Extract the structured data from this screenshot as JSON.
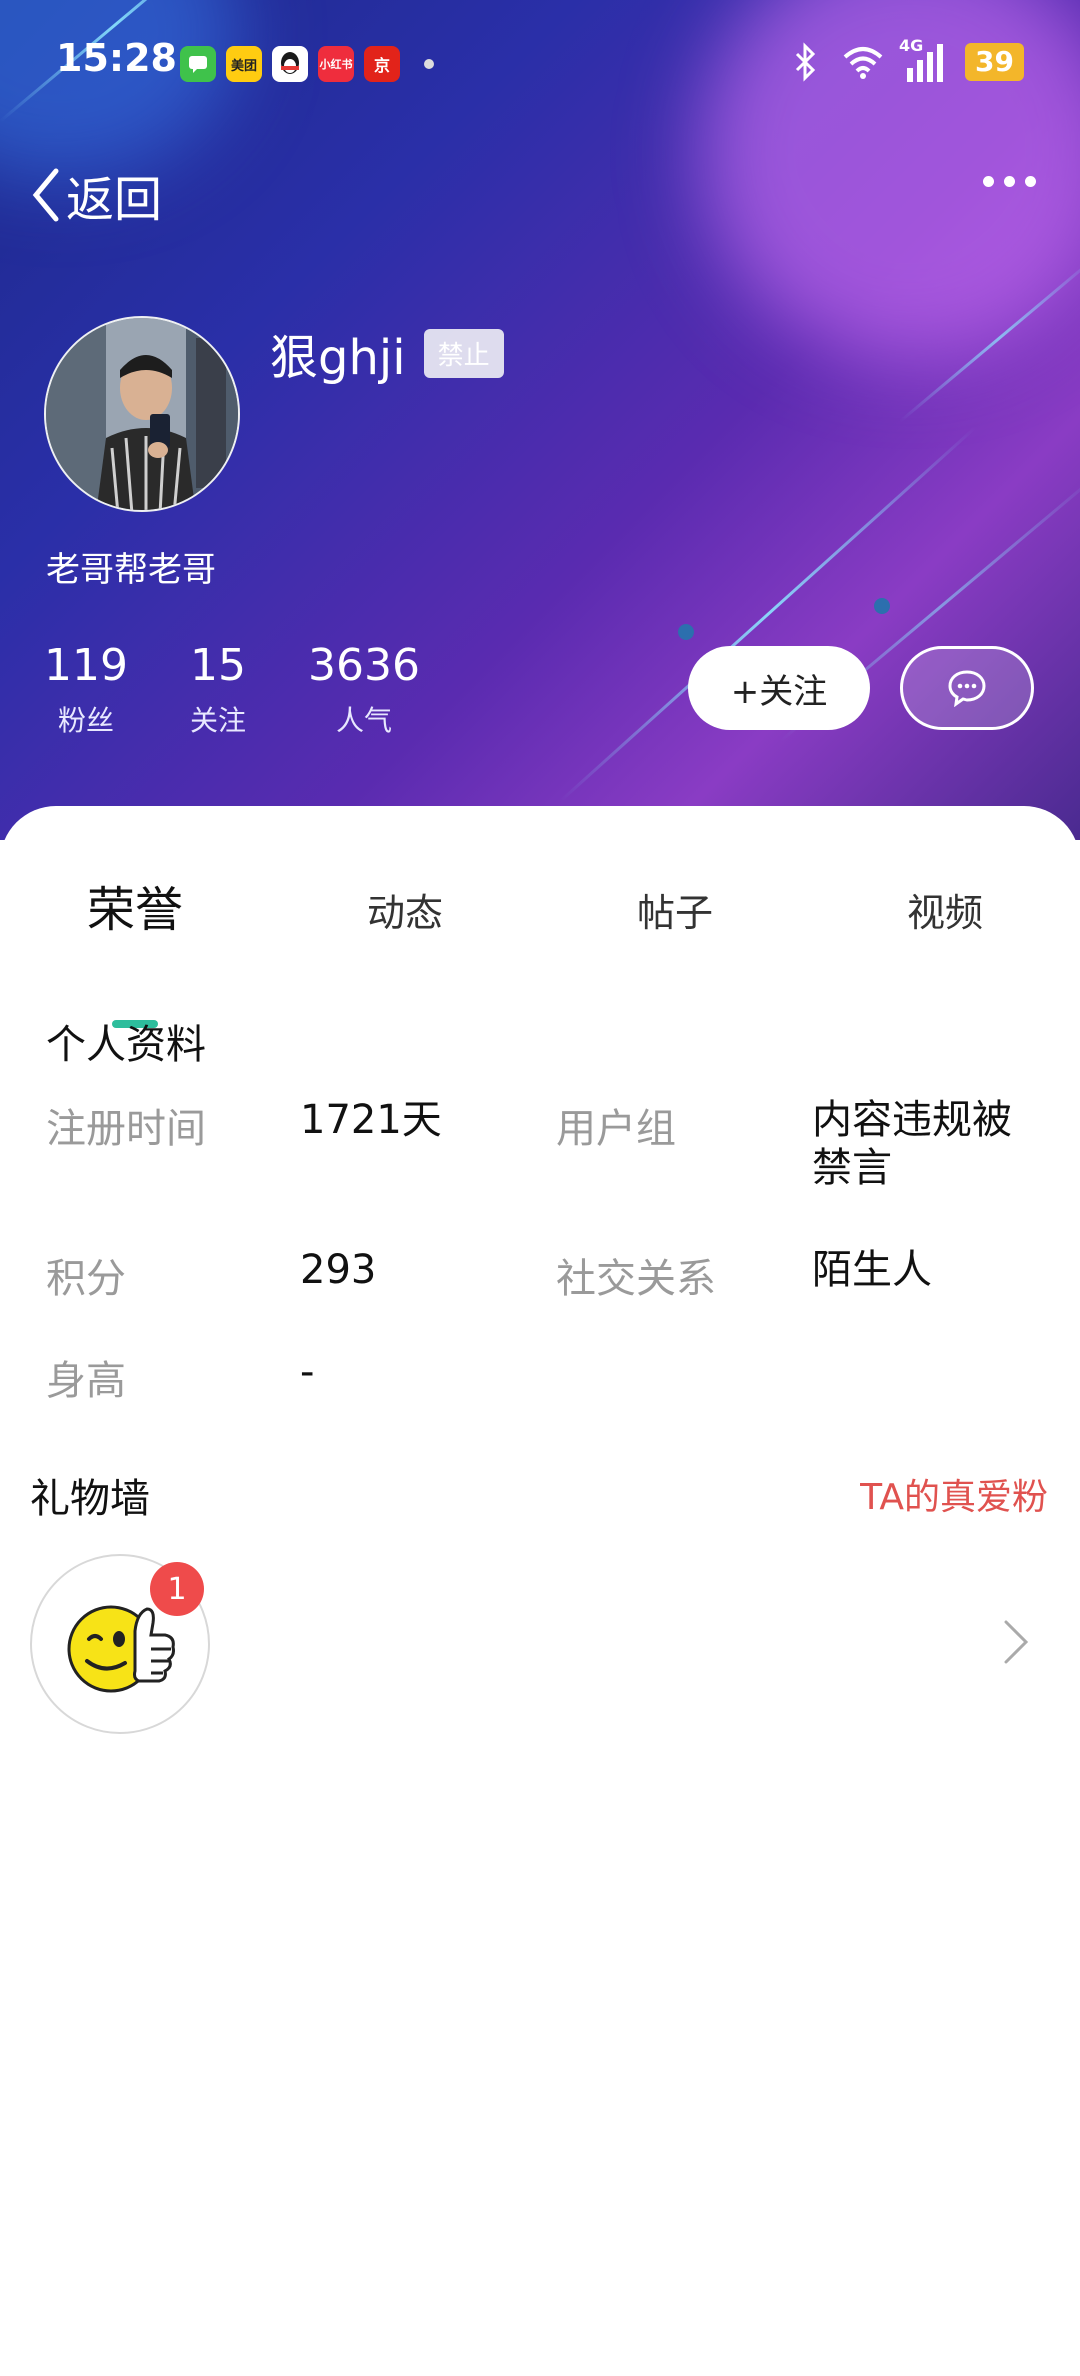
{
  "status_bar": {
    "time": "15:28",
    "app_icons": [
      {
        "name": "messages-icon",
        "label": "",
        "color": "#3fc24b"
      },
      {
        "name": "meituan-icon",
        "label": "美团",
        "color": "#ffcc11"
      },
      {
        "name": "qq-icon",
        "label": "",
        "color": "#1a7ee6"
      },
      {
        "name": "xiaohongshu-icon",
        "label": "小红书",
        "color": "#ef2d3d"
      },
      {
        "name": "jd-icon",
        "label": "京",
        "color": "#e2231a"
      }
    ],
    "network": "4G",
    "battery": "39"
  },
  "nav": {
    "back_label": "返回"
  },
  "profile": {
    "username": "狠ghji",
    "status_badge": "禁止",
    "signature": "老哥帮老哥",
    "stats": [
      {
        "value": "119",
        "label": "粉丝"
      },
      {
        "value": "15",
        "label": "关注"
      },
      {
        "value": "3636",
        "label": "人气"
      }
    ],
    "follow_label": "+关注"
  },
  "tabs": [
    "荣誉",
    "动态",
    "帖子",
    "视频"
  ],
  "active_tab": "荣誉",
  "personal_info": {
    "title": "个人资料",
    "rows": [
      {
        "key1": "注册时间",
        "val1": "1721天",
        "key2": "用户组",
        "val2": "内容违规被\n禁言"
      },
      {
        "key1": "积分",
        "val1": "293",
        "key2": "社交关系",
        "val2": "陌生人"
      },
      {
        "key1": "身高",
        "val1": "-"
      }
    ]
  },
  "gift_wall": {
    "title": "礼物墙",
    "link_label": "TA的真爱粉",
    "gift_count": "1"
  },
  "colors": {
    "accent_teal": "#2dbd9c",
    "link_red": "#e0524f",
    "badge_red": "#ef4b4b",
    "header_start": "#1c2a8c",
    "header_end": "#8a3cc4"
  }
}
